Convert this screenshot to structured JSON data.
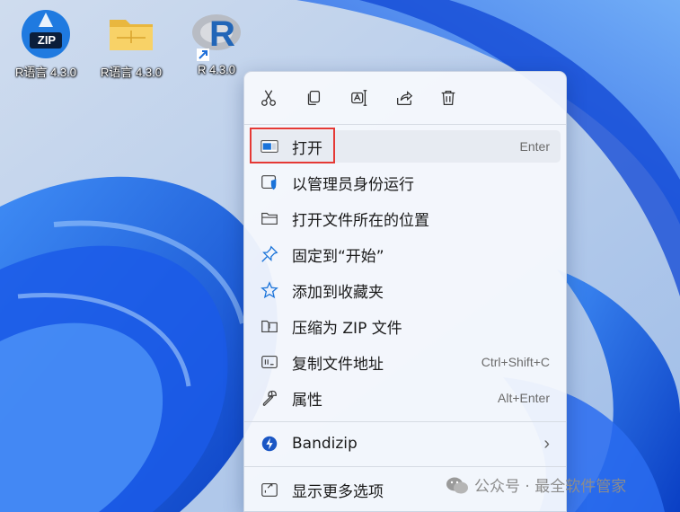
{
  "desktop": {
    "icons": [
      {
        "label": "R语言 4.3.0",
        "type": "zip-archive",
        "badge": "ZIP"
      },
      {
        "label": "R语言 4.3.0",
        "type": "folder"
      },
      {
        "label": "R 4.3.0",
        "type": "r-shortcut",
        "letter": "R"
      }
    ]
  },
  "menu": {
    "quick_actions": [
      {
        "name": "cut",
        "icon": "scissors-icon"
      },
      {
        "name": "copy",
        "icon": "copy-icon"
      },
      {
        "name": "rename",
        "icon": "rename-icon"
      },
      {
        "name": "share",
        "icon": "share-icon"
      },
      {
        "name": "delete",
        "icon": "trash-icon"
      }
    ],
    "items": [
      {
        "label": "打开",
        "shortcut": "Enter",
        "icon": "open-window-icon"
      },
      {
        "label": "以管理员身份运行",
        "shortcut": "",
        "icon": "shield-icon"
      },
      {
        "label": "打开文件所在的位置",
        "shortcut": "",
        "icon": "folder-icon"
      },
      {
        "label": "固定到“开始”",
        "shortcut": "",
        "icon": "pin-icon"
      },
      {
        "label": "添加到收藏夹",
        "shortcut": "",
        "icon": "star-icon"
      },
      {
        "label": "压缩为 ZIP 文件",
        "shortcut": "",
        "icon": "zip-icon"
      },
      {
        "label": "复制文件地址",
        "shortcut": "Ctrl+Shift+C",
        "icon": "copy-path-icon"
      },
      {
        "label": "属性",
        "shortcut": "Alt+Enter",
        "icon": "wrench-icon"
      }
    ],
    "bandizip": {
      "label": "Bandizip",
      "icon": "bandizip-icon",
      "arrow": "›"
    },
    "more": {
      "label": "显示更多选项",
      "icon": "more-options-icon"
    }
  },
  "watermark": {
    "text": "公众号 · 最全软件管家"
  },
  "colors": {
    "highlight": "#e53935",
    "accent": "#1a73d9"
  }
}
